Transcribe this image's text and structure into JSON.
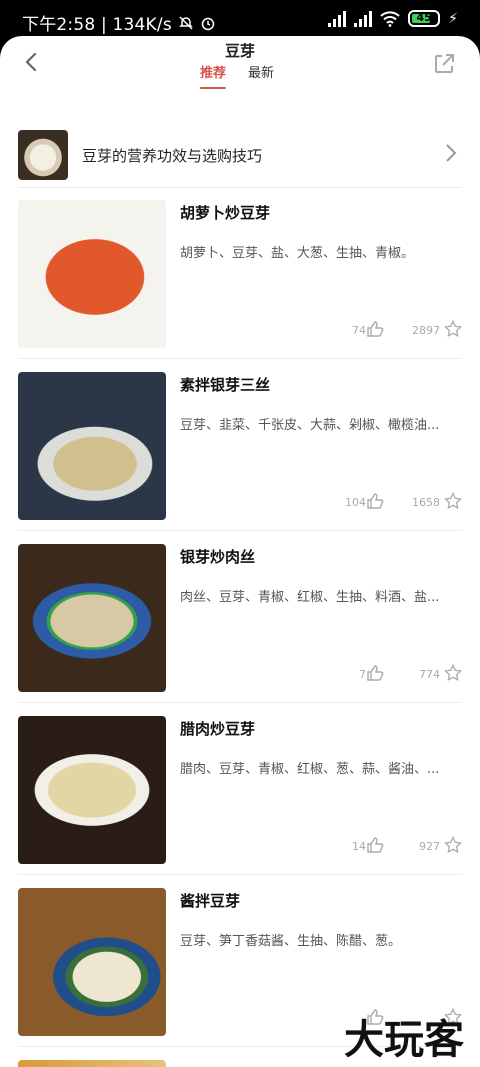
{
  "status": {
    "time_text": "下午2:58 | 134K/s",
    "battery": "45"
  },
  "header": {
    "title": "豆芽",
    "tabs": [
      {
        "label": "推荐",
        "active": true
      },
      {
        "label": "最新",
        "active": false
      }
    ]
  },
  "tip": {
    "text": "豆芽的营养功效与选购技巧"
  },
  "recipes": [
    {
      "title": "胡萝卜炒豆芽",
      "ingredients": "胡萝卜、豆芽、盐、大葱、生抽、青椒。",
      "likes": "74",
      "favorites": "2897"
    },
    {
      "title": "素拌银芽三丝",
      "ingredients": "豆芽、韭菜、千张皮、大蒜、剁椒、橄榄油...",
      "likes": "104",
      "favorites": "1658"
    },
    {
      "title": "银芽炒肉丝",
      "ingredients": "肉丝、豆芽、青椒、红椒、生抽、料酒、盐...",
      "likes": "7",
      "favorites": "774"
    },
    {
      "title": "腊肉炒豆芽",
      "ingredients": "腊肉、豆芽、青椒、红椒、葱、蒜、酱油、...",
      "likes": "14",
      "favorites": "927"
    },
    {
      "title": "酱拌豆芽",
      "ingredients": "豆芽、笋丁香菇酱、生抽、陈醋、葱。",
      "likes": "",
      "favorites": ""
    }
  ],
  "watermark": "大玩客",
  "colors": {
    "accent": "#d4534b",
    "divider": "#ececec",
    "muted": "#aaaaaa"
  },
  "icons": [
    "back-arrow-icon",
    "share-icon",
    "chevron-right-icon",
    "thumbs-up-icon",
    "star-icon"
  ]
}
